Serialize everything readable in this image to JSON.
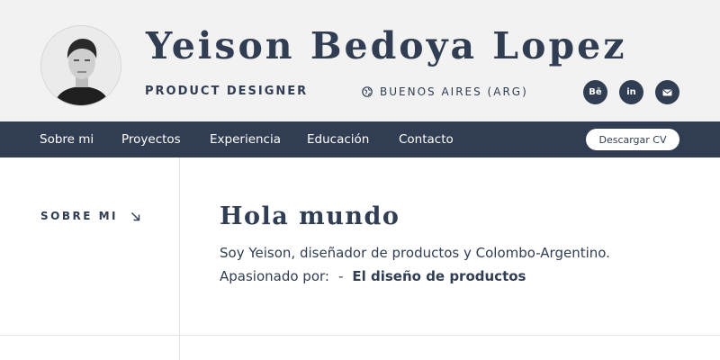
{
  "header": {
    "name": "Yeison Bedoya Lopez",
    "role": "PRODUCT DESIGNER",
    "location": "BUENOS AIRES (ARG)",
    "socials": [
      {
        "label": "Bē",
        "icon": "behance-icon"
      },
      {
        "label": "in",
        "icon": "linkedin-icon"
      },
      {
        "label": "",
        "icon": "mail-icon"
      }
    ]
  },
  "nav": {
    "items": [
      "Sobre mi",
      "Proyectos",
      "Experiencia",
      "Educación",
      "Contacto"
    ],
    "cv_label": "Descargar CV"
  },
  "about": {
    "section_label": "SOBRE MI",
    "heading": "Hola mundo",
    "intro": "Soy Yeison, diseñador de productos y Colombo-Argentino.",
    "passion_label": "Apasionado por:",
    "passion_separator": "-",
    "passion_value": "El diseño de productos"
  },
  "colors": {
    "primary": "#303d52",
    "header_bg": "#f2f2f2",
    "background": "#ffffff"
  }
}
